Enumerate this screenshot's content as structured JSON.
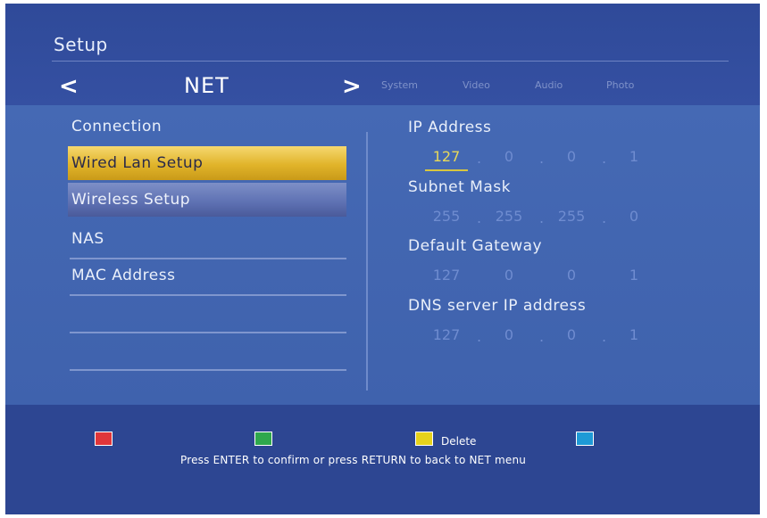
{
  "header": {
    "title": "Setup",
    "current_tab": "NET",
    "prev_arrow": "<",
    "next_arrow": ">",
    "tabs": [
      "System",
      "Video",
      "Audio",
      "Photo"
    ]
  },
  "menu": {
    "heading": "Connection",
    "items": [
      {
        "label": "Wired Lan Setup",
        "state": "highlighted"
      },
      {
        "label": "Wireless Setup",
        "state": "selected"
      },
      {
        "label": "NAS"
      },
      {
        "label": "MAC Address"
      }
    ]
  },
  "fields": [
    {
      "label": "IP Address",
      "octets": [
        "127",
        "0",
        "0",
        "1"
      ],
      "active_octet": 0
    },
    {
      "label": "Subnet Mask",
      "octets": [
        "255",
        "255",
        "255",
        "0"
      ]
    },
    {
      "label": "Default Gateway",
      "octets": [
        "127",
        "0",
        "0",
        "1"
      ]
    },
    {
      "label": "DNS server IP address",
      "octets": [
        "127",
        "0",
        "0",
        "1"
      ]
    }
  ],
  "footer": {
    "keys": [
      {
        "color": "#e0363a",
        "name": "red-key",
        "label": ""
      },
      {
        "color": "#2fa84d",
        "name": "green-key",
        "label": ""
      },
      {
        "color": "#e6d21c",
        "name": "yellow-key",
        "label": "Delete"
      },
      {
        "color": "#1e9ad6",
        "name": "blue-key",
        "label": ""
      }
    ],
    "hint": "Press ENTER to confirm or press RETURN to back to NET menu"
  }
}
